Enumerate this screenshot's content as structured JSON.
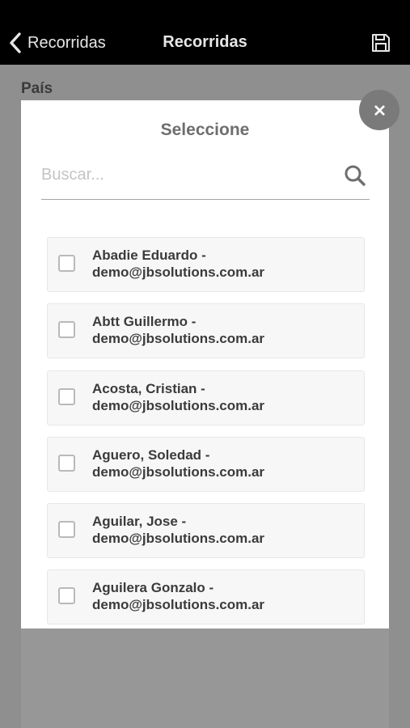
{
  "navbar": {
    "back_label": "Recorridas",
    "title": "Recorridas",
    "save_icon": "floppy-disk-icon"
  },
  "background": {
    "field_label": "País"
  },
  "modal": {
    "title": "Seleccione",
    "close_icon": "close-icon",
    "search": {
      "placeholder": "Buscar...",
      "value": ""
    },
    "items": [
      {
        "name": "Abadie Eduardo -",
        "email": "demo@jbsolutions.com.ar",
        "checked": false
      },
      {
        "name": "Abtt Guillermo -",
        "email": "demo@jbsolutions.com.ar",
        "checked": false
      },
      {
        "name": "Acosta, Cristian -",
        "email": "demo@jbsolutions.com.ar",
        "checked": false
      },
      {
        "name": "Aguero, Soledad -",
        "email": "demo@jbsolutions.com.ar",
        "checked": false
      },
      {
        "name": "Aguilar, Jose -",
        "email": "demo@jbsolutions.com.ar",
        "checked": false
      },
      {
        "name": "Aguilera Gonzalo -",
        "email": "demo@jbsolutions.com.ar",
        "checked": false
      }
    ]
  },
  "colors": {
    "navbar_bg": "#000000",
    "overlay": "#8f8f8f",
    "close_button": "#7a7a7a"
  }
}
